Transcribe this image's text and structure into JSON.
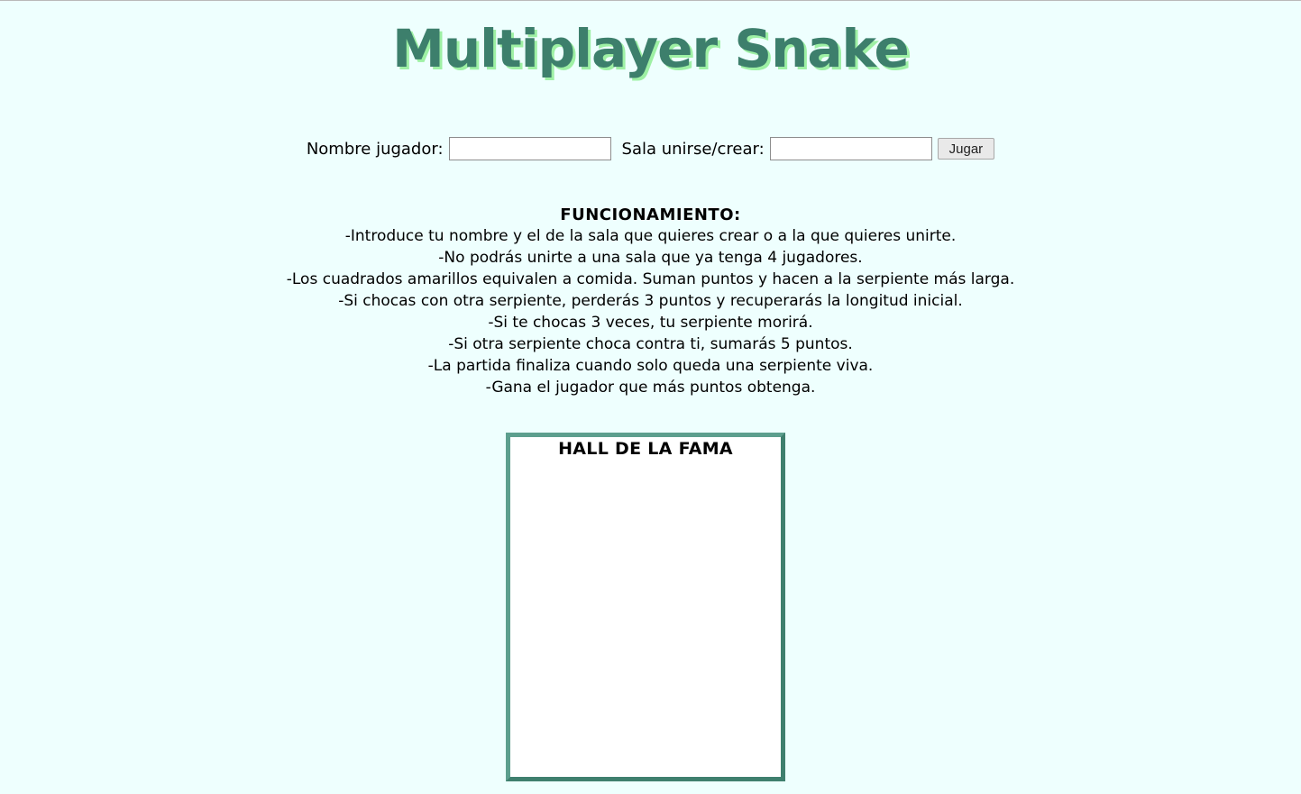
{
  "page": {
    "title": "Multiplayer Snake",
    "title_color": "#3d7f6c",
    "title_shadow_color": "#9ef0a4",
    "background": "#eefffe"
  },
  "form": {
    "player_label": "Nombre jugador:",
    "player_value": "",
    "player_placeholder": "",
    "room_label": "Sala unirse/crear:",
    "room_value": "",
    "room_placeholder": "",
    "play_label": "Jugar"
  },
  "rules": {
    "heading": "FUNCIONAMIENTO:",
    "items": [
      "-Introduce tu nombre y el de la sala que quieres crear o a la que quieres unirte.",
      "-No podrás unirte a una sala que ya tenga 4 jugadores.",
      "-Los cuadrados amarillos equivalen a comida. Suman puntos y hacen a la serpiente más larga.",
      "-Si chocas con otra serpiente, perderás 3 puntos y recuperarás la longitud inicial.",
      "-Si te chocas 3 veces, tu serpiente morirá.",
      "-Si otra serpiente choca contra ti, sumarás 5 puntos.",
      "-La partida finaliza cuando solo queda una serpiente viva.",
      "-Gana el jugador que más puntos obtenga."
    ]
  },
  "hall_of_fame": {
    "title": "HALL DE LA FAMA",
    "border_color": "#4a8a78",
    "entries": []
  }
}
